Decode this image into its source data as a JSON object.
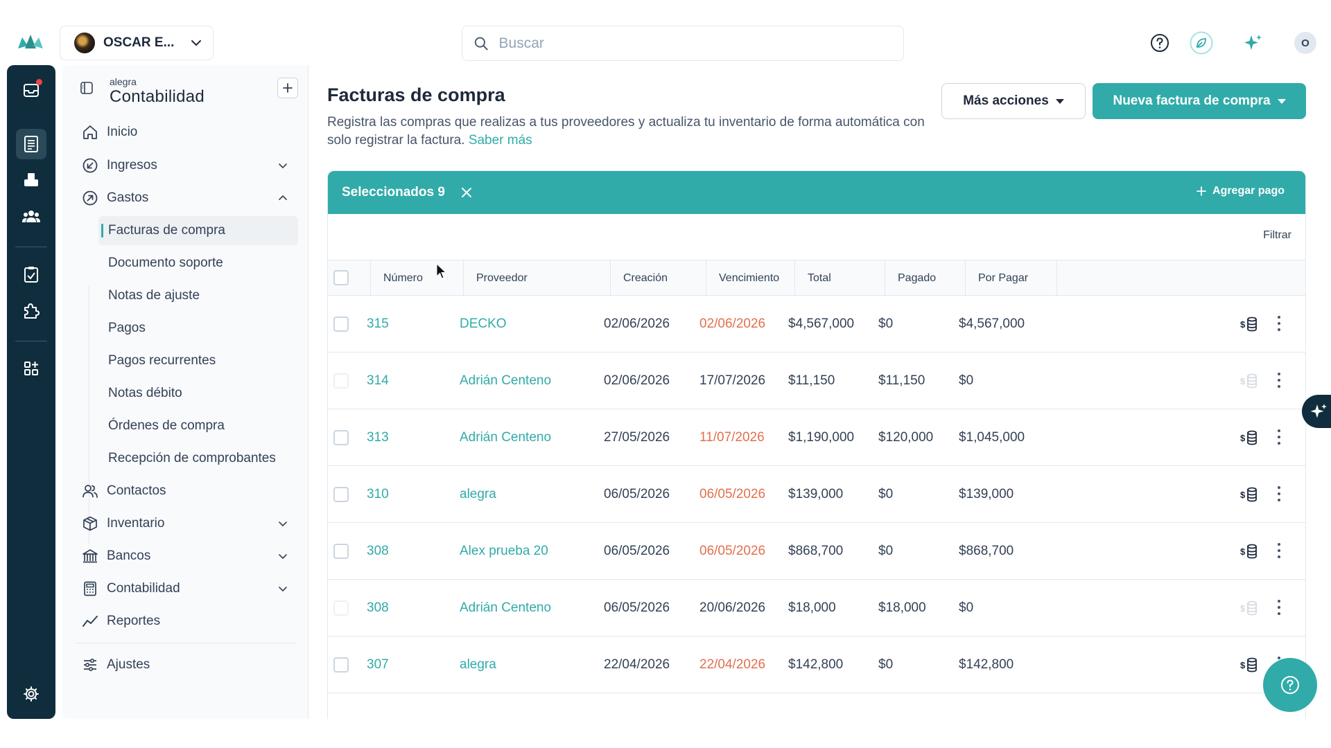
{
  "colors": {
    "accent": "#30aba9",
    "dark_rail": "#0f2d3d",
    "overdue": "#e26f4c",
    "notification": "#ef4444"
  },
  "topbar": {
    "company_name": "OSCAR E...",
    "search_placeholder": "Buscar",
    "user_initial": "O",
    "icons": [
      "help-circle-icon",
      "leaf-icon",
      "sparkles-icon"
    ]
  },
  "rail": {
    "icons": [
      "notification-inbox-icon",
      "invoices-icon",
      "pos-icon",
      "contacts-group-icon",
      "checklist-icon",
      "puzzle-icon",
      "apps-icon",
      "gear-icon"
    ]
  },
  "sidebar": {
    "brand_small": "alegra",
    "brand_big": "Contabilidad",
    "items": [
      {
        "label": "Inicio",
        "icon": "home-icon"
      },
      {
        "label": "Ingresos",
        "icon": "income-icon"
      },
      {
        "label": "Gastos",
        "icon": "expenses-icon"
      },
      {
        "label": "Contactos",
        "icon": "contacts-icon"
      },
      {
        "label": "Inventario",
        "icon": "box-icon"
      },
      {
        "label": "Bancos",
        "icon": "bank-icon"
      },
      {
        "label": "Contabilidad",
        "icon": "calculator-icon"
      },
      {
        "label": "Reportes",
        "icon": "chart-line-icon"
      },
      {
        "label": "Ajustes",
        "icon": "sliders-icon"
      }
    ],
    "gastos_sub": [
      "Facturas de compra",
      "Documento soporte",
      "Notas de ajuste",
      "Pagos",
      "Pagos recurrentes",
      "Notas débito",
      "Órdenes de compra",
      "Recepción de comprobantes"
    ]
  },
  "page": {
    "title": "Facturas de compra",
    "description": "Registra las compras que realizas a tus proveedores y actualiza tu inventario de forma automática con solo registrar la factura.",
    "learn_more": "Saber más",
    "more_actions": "Más acciones",
    "new_invoice": "Nueva factura de compra"
  },
  "selection": {
    "label": "Seleccionados 9",
    "add_payment": "Agregar pago"
  },
  "table": {
    "filter": "Filtrar",
    "headers": [
      "Número",
      "Proveedor",
      "Creación",
      "Vencimiento",
      "Total",
      "Pagado",
      "Por Pagar"
    ],
    "rows": [
      {
        "number": "315",
        "vendor": "DECKO",
        "created": "02/06/2026",
        "due": "02/06/2026",
        "overdue": true,
        "total": "$4,567,000",
        "paid": "$0",
        "pending": "$4,567,000",
        "enabled": true
      },
      {
        "number": "314",
        "vendor": "Adrián Centeno",
        "created": "02/06/2026",
        "due": "17/07/2026",
        "overdue": false,
        "total": "$11,150",
        "paid": "$11,150",
        "pending": "$0",
        "enabled": false
      },
      {
        "number": "313",
        "vendor": "Adrián Centeno",
        "created": "27/05/2026",
        "due": "11/07/2026",
        "overdue": true,
        "total": "$1,190,000",
        "paid": "$120,000",
        "pending": "$1,045,000",
        "enabled": true
      },
      {
        "number": "310",
        "vendor": "alegra",
        "created": "06/05/2026",
        "due": "06/05/2026",
        "overdue": true,
        "total": "$139,000",
        "paid": "$0",
        "pending": "$139,000",
        "enabled": true
      },
      {
        "number": "308",
        "vendor": "Alex prueba 20",
        "created": "06/05/2026",
        "due": "06/05/2026",
        "overdue": true,
        "total": "$868,700",
        "paid": "$0",
        "pending": "$868,700",
        "enabled": true
      },
      {
        "number": "308",
        "vendor": "Adrián Centeno",
        "created": "06/05/2026",
        "due": "20/06/2026",
        "overdue": false,
        "total": "$18,000",
        "paid": "$18,000",
        "pending": "$0",
        "enabled": false
      },
      {
        "number": "307",
        "vendor": "alegra",
        "created": "22/04/2026",
        "due": "22/04/2026",
        "overdue": true,
        "total": "$142,800",
        "paid": "$0",
        "pending": "$142,800",
        "enabled": true
      }
    ]
  }
}
